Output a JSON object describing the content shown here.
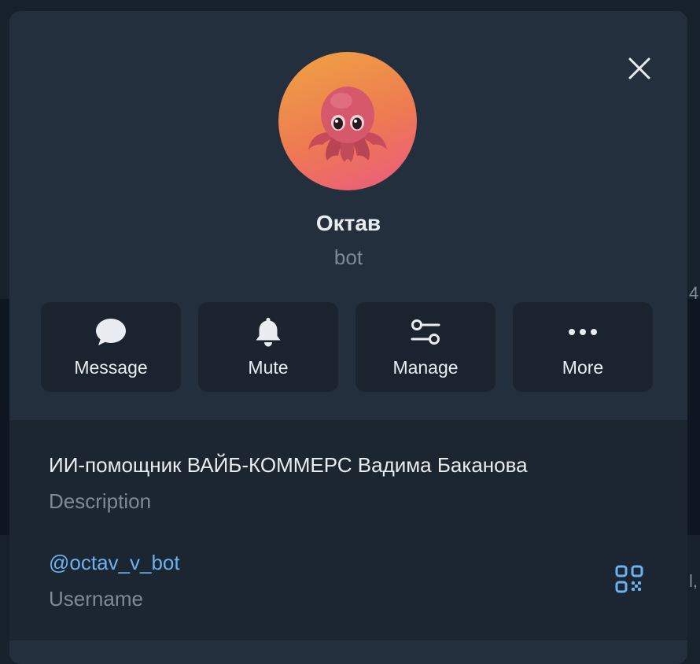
{
  "profile": {
    "name": "Октав",
    "subtitle": "bot",
    "avatar_emoji": "octopus",
    "avatar_colors": [
      "#efa443",
      "#ee7a52",
      "#ea5a80"
    ]
  },
  "actions": [
    {
      "label": "Message",
      "icon": "message-bubble-icon"
    },
    {
      "label": "Mute",
      "icon": "bell-icon"
    },
    {
      "label": "Manage",
      "icon": "sliders-icon"
    },
    {
      "label": "More",
      "icon": "more-dots-icon"
    }
  ],
  "info": {
    "description": "ИИ-помощник ВАЙБ-КОММЕРС Вадима Баканова",
    "description_caption": "Description",
    "username": "@octav_v_bot",
    "username_caption": "Username"
  },
  "background": {
    "glyph_1": "4",
    "glyph_2": "l,"
  },
  "colors": {
    "panel": "#242f3d",
    "page_bg": "#17212b",
    "accent_link": "#6ab2f2",
    "muted_text": "#7e8a97",
    "primary_text": "#e9edf1"
  }
}
